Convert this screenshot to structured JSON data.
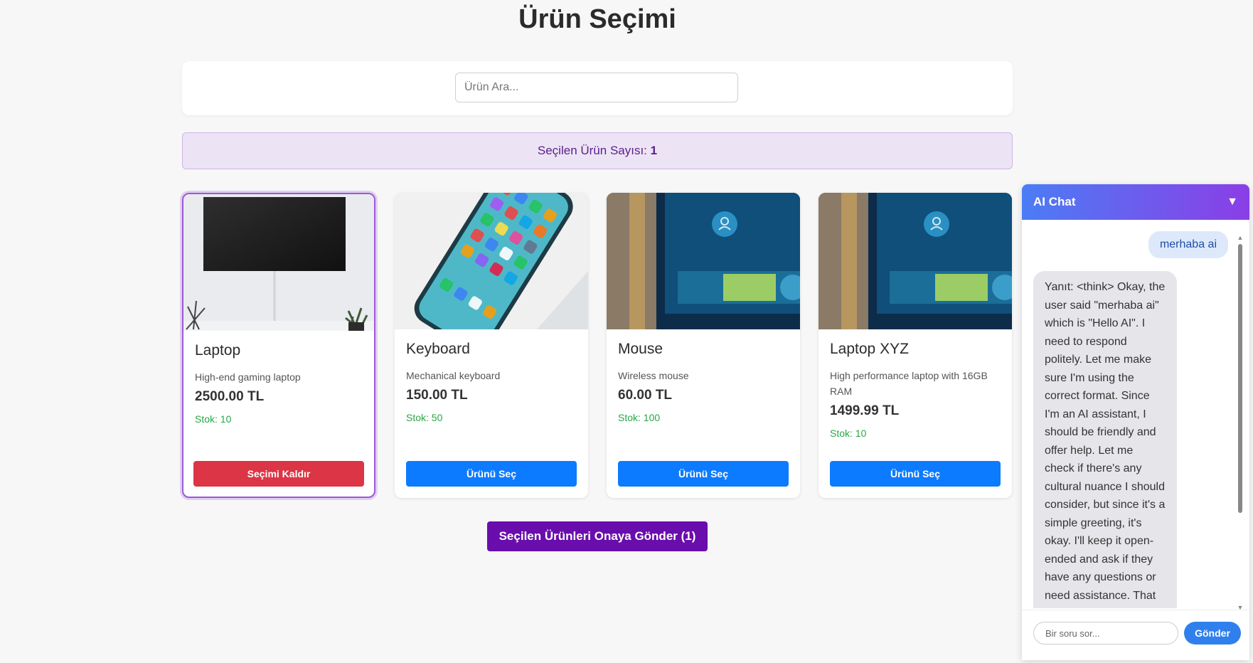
{
  "page": {
    "title": "Ürün Seçimi"
  },
  "search": {
    "placeholder": "Ürün Ara..."
  },
  "selection": {
    "label": "Seçilen Ürün Sayısı:",
    "count": "1"
  },
  "products": [
    {
      "name": "Laptop",
      "description": "High-end gaming laptop",
      "price": "2500.00 TL",
      "stock": "Stok: 10",
      "button": "Seçimi Kaldır",
      "selected": true,
      "image": "tv-wall-photo"
    },
    {
      "name": "Keyboard",
      "description": "Mechanical keyboard",
      "price": "150.00 TL",
      "stock": "Stok: 50",
      "button": "Ürünü Seç",
      "selected": false,
      "image": "smartphone-photo"
    },
    {
      "name": "Mouse",
      "description": "Wireless mouse",
      "price": "60.00 TL",
      "stock": "Stok: 100",
      "button": "Ürünü Seç",
      "selected": false,
      "image": "smart-tv-screen-photo"
    },
    {
      "name": "Laptop XYZ",
      "description": "High performance laptop with 16GB RAM",
      "price": "1499.99 TL",
      "stock": "Stok: 10",
      "button": "Ürünü Seç",
      "selected": false,
      "image": "smart-tv-screen-photo"
    }
  ],
  "submit": {
    "label": "Seçilen Ürünleri Onaya Gönder (1)"
  },
  "chat": {
    "title": "AI Chat",
    "toggle_icon": "▼",
    "messages": [
      {
        "role": "user",
        "text": "merhaba ai"
      },
      {
        "role": "ai",
        "text": "Yanıt: <think> Okay, the user said \"merhaba ai\" which is \"Hello AI\". I need to respond politely. Let me make sure I'm using the correct format. Since I'm an AI assistant, I should be friendly and offer help. Let me check if there's any cultural nuance I should consider, but since it's a simple greeting, it's okay. I'll keep it open-ended and ask if they have any questions or need assistance. That should cover it. </think>"
      }
    ],
    "input_placeholder": "Bir soru sor...",
    "send_label": "Gönder"
  },
  "colors": {
    "accent_purple": "#6a0dad",
    "primary_blue": "#0d7bff",
    "danger_red": "#dc3545",
    "stock_green": "#28a745"
  }
}
